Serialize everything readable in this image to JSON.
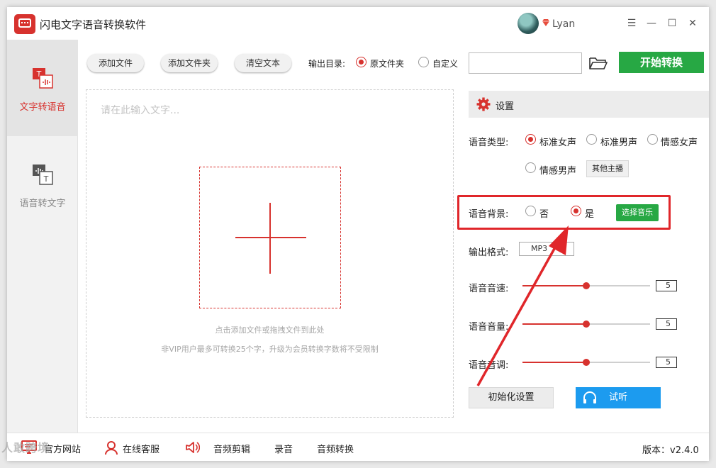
{
  "app": {
    "title": "闪电文字语音转换软件",
    "username": "Lyan"
  },
  "window_controls": {
    "menu": "☰",
    "minimize": "—",
    "maximize": "☐",
    "close": "✕"
  },
  "nav": [
    {
      "label": "文字转语音",
      "active": true
    },
    {
      "label": "语音转文字",
      "active": false
    }
  ],
  "toolbar": {
    "add_file": "添加文件",
    "add_folder": "添加文件夹",
    "clear_text": "清空文本",
    "output_dir_label": "输出目录:",
    "option_original": "原文件夹",
    "option_custom": "自定义",
    "selected_output": "原文件夹",
    "path_value": "",
    "start": "开始转换"
  },
  "editor": {
    "placeholder": "请在此输入文字...",
    "drop_hint": "点击添加文件或拖拽文件到此处",
    "vip_hint": "非VIP用户最多可转换25个字，升级为会员转换字数将不受限制"
  },
  "settings": {
    "title": "设置",
    "voice_type_label": "语音类型:",
    "voice_types": [
      "标准女声",
      "标准男声",
      "情感女声",
      "情感男声"
    ],
    "selected_voice": "标准女声",
    "other_anchor": "其他主播",
    "background_label": "语音背景:",
    "background_options": [
      "否",
      "是"
    ],
    "selected_background": "是",
    "choose_music": "选择音乐",
    "format_label": "输出格式:",
    "format_value": "MP3",
    "speed_label": "语音音速:",
    "speed_value": "5",
    "volume_label": "语音音量:",
    "volume_value": "5",
    "pitch_label": "语音音调:",
    "pitch_value": "5",
    "slider_max": 10,
    "reset": "初始化设置",
    "listen": "试听"
  },
  "footer": {
    "website": "官方网站",
    "service": "在线客服",
    "audio_edit": "音频剪辑",
    "record": "录音",
    "audio_convert": "音频转换",
    "version": "版本：v2.4.0"
  },
  "watermark": "人敢跨境",
  "colors": {
    "accent": "#d7322e",
    "green": "#27a844",
    "blue": "#1c9bef"
  }
}
